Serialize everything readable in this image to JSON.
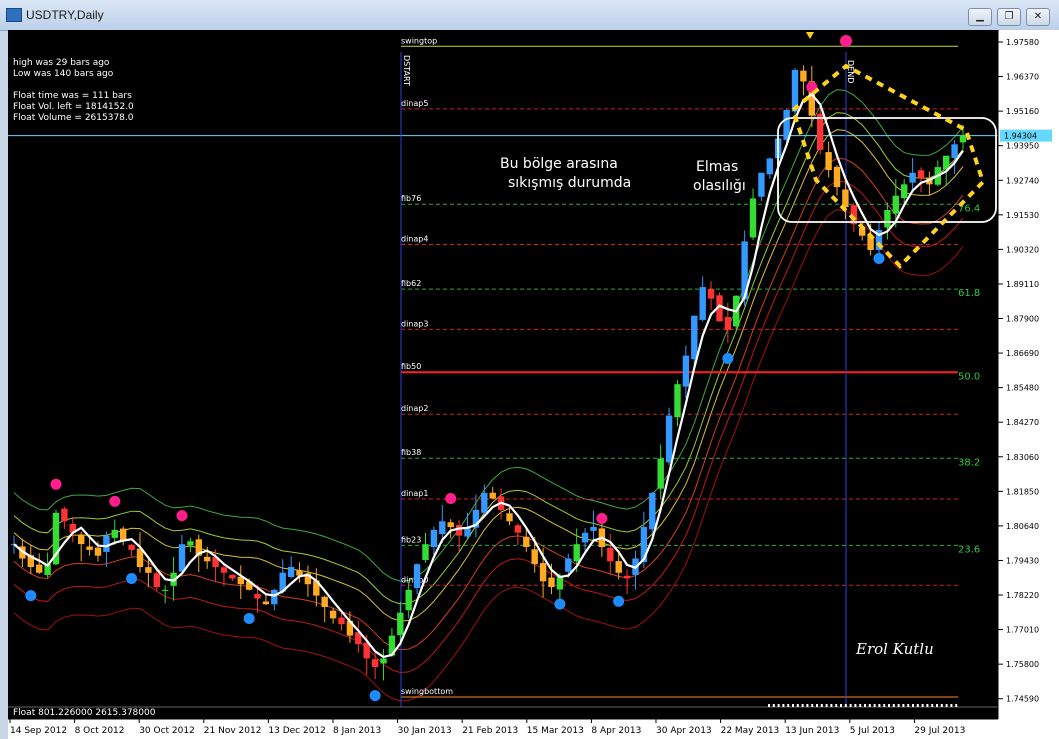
{
  "window": {
    "title": "USDTRY,Daily"
  },
  "info_lines": [
    "high was   29  bars ago",
    "Low was    140 bars ago",
    "",
    "Float time was  =     111 bars",
    "Float Vol. left   =    1814152.0",
    "Float Volume     =   2615378.0"
  ],
  "annotations": {
    "region_text_1": "Bu bölge arasına",
    "region_text_2": "sıkışmış durumda",
    "diamond_text_1": "Elmas",
    "diamond_text_2": "olasılığı",
    "signature": "Erol Kutlu"
  },
  "float_bar": "Float 801.226000 2615.378000",
  "colors": {
    "background": "#000000",
    "bull": "#33dd33",
    "bear": "#ff3333",
    "ma_white": "#ffffff",
    "fib50": "#ff2020",
    "current_line": "#66d8ff"
  },
  "chart_data": {
    "type": "candlestick",
    "symbol": "USDTRY",
    "timeframe": "Daily",
    "ylim": [
      1.743,
      1.98
    ],
    "y_ticks": [
      "1.97580",
      "1.96370",
      "1.95160",
      "1.93950",
      "1.92740",
      "1.91530",
      "1.90320",
      "1.89110",
      "1.87900",
      "1.86690",
      "1.85480",
      "1.84270",
      "1.83060",
      "1.81850",
      "1.80640",
      "1.79430",
      "1.78220",
      "1.77010",
      "1.75800",
      "1.74590"
    ],
    "current_price": "1.94304",
    "x_ticks": [
      "14 Sep 2012",
      "8 Oct 2012",
      "30 Oct 2012",
      "21 Nov 2012",
      "13 Dec 2012",
      "8 Jan 2013",
      "30 Jan 2013",
      "21 Feb 2013",
      "15 Mar 2013",
      "8 Apr 2013",
      "30 Apr 2013",
      "22 May 2013",
      "13 Jun 2013",
      "5 Jul 2013",
      "29 Jul 2013"
    ],
    "close_path": [
      1.8,
      1.795,
      1.792,
      1.79,
      1.793,
      1.811,
      1.808,
      1.804,
      1.8,
      1.798,
      1.796,
      1.803,
      1.805,
      1.801,
      1.798,
      1.792,
      1.79,
      1.785,
      1.784,
      1.79,
      1.8,
      1.801,
      1.796,
      1.794,
      1.792,
      1.79,
      1.788,
      1.786,
      1.784,
      1.781,
      1.779,
      1.784,
      1.79,
      1.792,
      1.789,
      1.786,
      1.782,
      1.778,
      1.774,
      1.772,
      1.768,
      1.765,
      1.76,
      1.757,
      1.76,
      1.768,
      1.776,
      1.784,
      1.793,
      1.8,
      1.805,
      1.808,
      1.806,
      1.803,
      1.806,
      1.812,
      1.818,
      1.816,
      1.812,
      1.808,
      1.804,
      1.799,
      1.793,
      1.787,
      1.785,
      1.789,
      1.795,
      1.8,
      1.804,
      1.806,
      1.799,
      1.794,
      1.79,
      1.788,
      1.795,
      1.806,
      1.818,
      1.83,
      1.845,
      1.856,
      1.866,
      1.88,
      1.89,
      1.886,
      1.878,
      1.875,
      1.887,
      1.906,
      1.921,
      1.93,
      1.935,
      1.942,
      1.952,
      1.966,
      1.962,
      1.95,
      1.938,
      1.931,
      1.925,
      1.918,
      1.912,
      1.908,
      1.903,
      1.91,
      1.917,
      1.922,
      1.926,
      1.93,
      1.928,
      1.926,
      1.932,
      1.936,
      1.94,
      1.943
    ],
    "swing_top": "swingtop",
    "swing_bottom": "swingbottom",
    "dstart_label": "DSTART",
    "dend_label": "DEND",
    "levels": [
      {
        "name": "swingtop",
        "price": 1.9743,
        "color": "#b8e030",
        "style": "solid"
      },
      {
        "name": "dinap5",
        "price": 1.9524,
        "color": "#cc2222",
        "style": "dash"
      },
      {
        "name": "fib76",
        "price": 1.919,
        "color": "#33aa33",
        "style": "dash"
      },
      {
        "name": "dinap4",
        "price": 1.9049,
        "color": "#cc2222",
        "style": "dash"
      },
      {
        "name": "fib62",
        "price": 1.8893,
        "color": "#33aa33",
        "style": "dash"
      },
      {
        "name": "dinap3",
        "price": 1.8752,
        "color": "#cc2222",
        "style": "dash"
      },
      {
        "name": "fib50",
        "price": 1.8602,
        "color": "#ff2020",
        "style": "solid"
      },
      {
        "name": "dinap2",
        "price": 1.8455,
        "color": "#cc2222",
        "style": "dash"
      },
      {
        "name": "fib38",
        "price": 1.8301,
        "color": "#33aa33",
        "style": "dash"
      },
      {
        "name": "dinap1",
        "price": 1.8158,
        "color": "#cc2222",
        "style": "dash"
      },
      {
        "name": "fib23",
        "price": 1.7996,
        "color": "#33aa33",
        "style": "dash"
      },
      {
        "name": "dinap0",
        "price": 1.7856,
        "color": "#cc2222",
        "style": "dash"
      },
      {
        "name": "swingbottom",
        "price": 1.7465,
        "color": "#ff8820",
        "style": "solid"
      }
    ],
    "level_pct_labels": [
      {
        "text": "76.4",
        "price": 1.9179
      },
      {
        "text": "61.8",
        "price": 1.8882
      },
      {
        "text": "50.0",
        "price": 1.8591
      },
      {
        "text": "38.2",
        "price": 1.829
      },
      {
        "text": "23.6",
        "price": 1.7985
      }
    ]
  }
}
